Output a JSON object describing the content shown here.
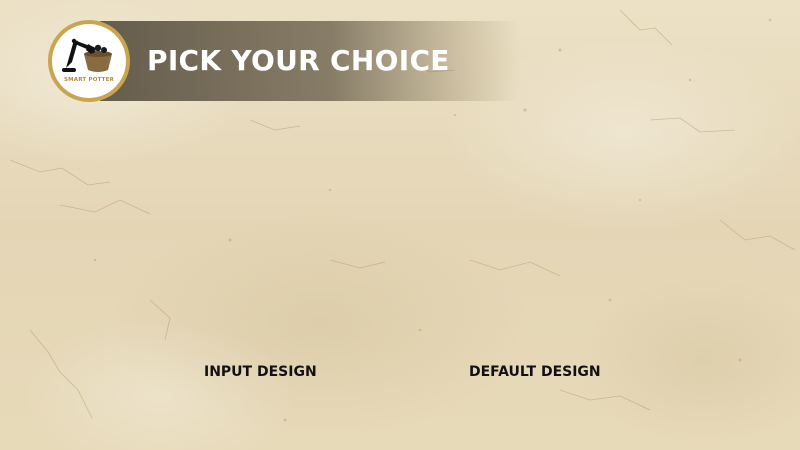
{
  "header": {
    "title": "PICK YOUR CHOICE",
    "logo": {
      "text": "SMART POTTER",
      "icon": "excavator-pot-icon",
      "ring_color": "#c9a64e"
    },
    "banner_color": "#5a5041"
  },
  "options": {
    "input_design_label": "INPUT DESIGN",
    "default_design_label": "DEFAULT DESIGN"
  },
  "colors": {
    "background": "#e8dbbd",
    "title_text": "#ffffff",
    "option_text": "#111111"
  }
}
